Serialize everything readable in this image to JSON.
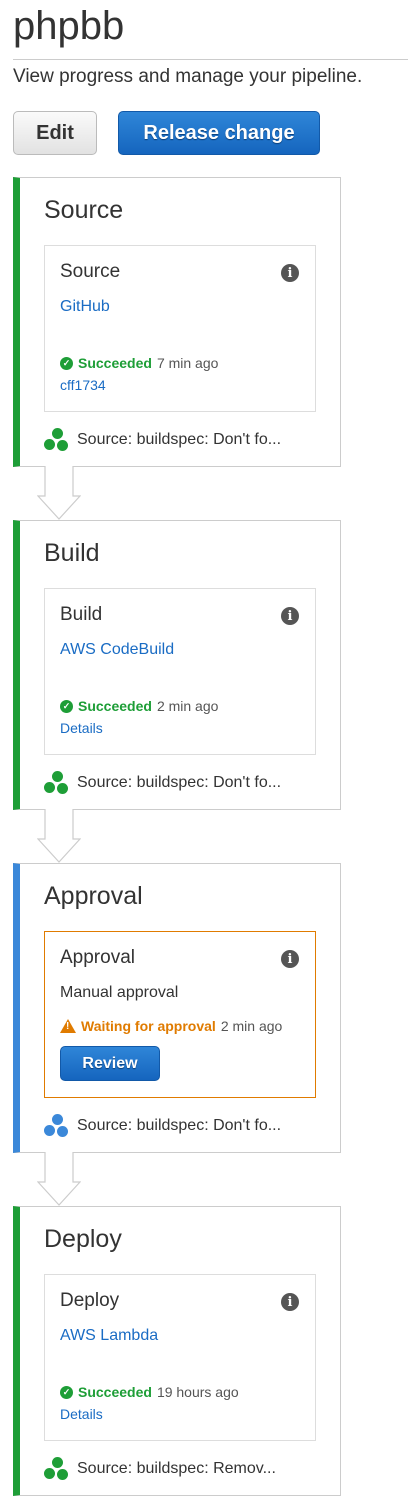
{
  "header": {
    "title": "phpbb",
    "subtitle": "View progress and manage your pipeline."
  },
  "toolbar": {
    "edit_label": "Edit",
    "release_label": "Release change"
  },
  "colors": {
    "success": "#1e9e37",
    "in_progress": "#3b88d9",
    "warning": "#e07b00",
    "link": "#1a6cc4"
  },
  "stages": [
    {
      "title": "Source",
      "action": {
        "title": "Source",
        "provider": "GitHub",
        "status": "Succeeded",
        "time": "7 min ago",
        "link": "cff1734"
      },
      "footer": "Source: buildspec: Don't fo..."
    },
    {
      "title": "Build",
      "action": {
        "title": "Build",
        "provider": "AWS CodeBuild",
        "status": "Succeeded",
        "time": "2 min ago",
        "link": "Details"
      },
      "footer": "Source: buildspec: Don't fo..."
    },
    {
      "title": "Approval",
      "action": {
        "title": "Approval",
        "provider": "Manual approval",
        "status": "Waiting for approval",
        "time": "2 min ago",
        "button": "Review"
      },
      "footer": "Source: buildspec: Don't fo..."
    },
    {
      "title": "Deploy",
      "action": {
        "title": "Deploy",
        "provider": "AWS Lambda",
        "status": "Succeeded",
        "time": "19 hours ago",
        "link": "Details"
      },
      "footer": "Source: buildspec: Remov..."
    }
  ]
}
